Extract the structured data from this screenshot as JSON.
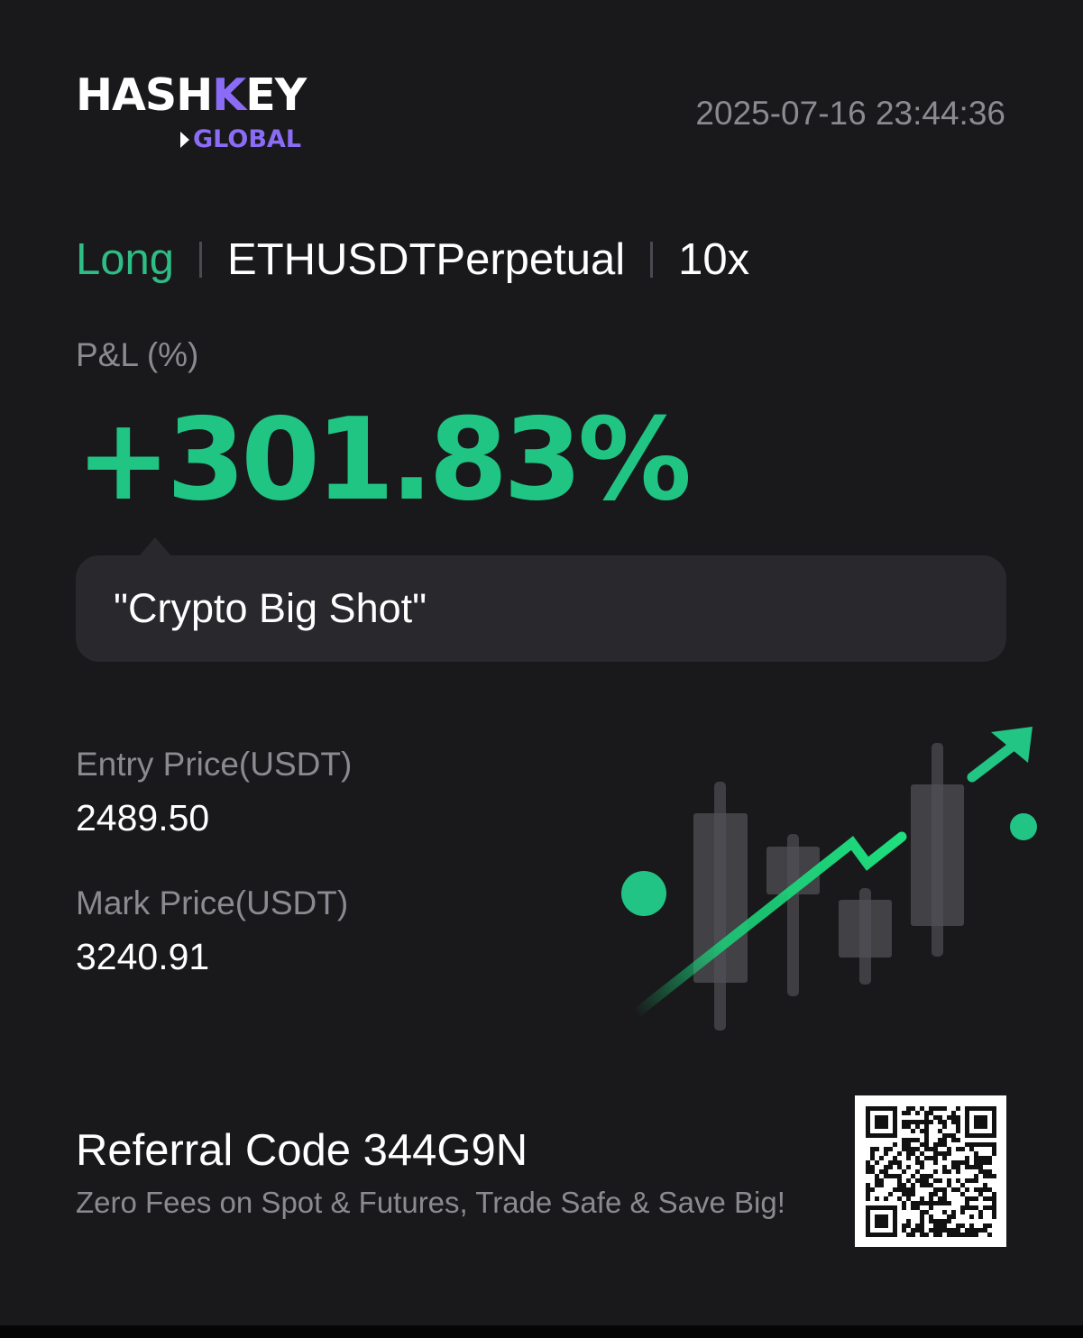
{
  "brand": {
    "logo_main": "HASHKEY",
    "logo_sub": "GLOBAL"
  },
  "timestamp": "2025-07-16 23:44:36",
  "position": {
    "side": "Long",
    "symbol": "ETHUSDTPerpetual",
    "leverage": "10x"
  },
  "pnl": {
    "label": "P&L (%)",
    "value": "+301.83%"
  },
  "quote": "\"Crypto Big Shot\"",
  "prices": {
    "entry_label": "Entry Price(USDT)",
    "entry_value": "2489.50",
    "mark_label": "Mark Price(USDT)",
    "mark_value": "3240.91"
  },
  "referral": {
    "code_text": "Referral Code 344G9N",
    "tagline": "Zero Fees on Spot & Futures, Trade Safe & Save Big!"
  },
  "colors": {
    "background": "#19191b",
    "long_green": "#2ebd85",
    "pnl_green": "#20c584",
    "brand_purple": "#8b6cf6",
    "muted_text": "#8a8a90",
    "quote_box": "#29292d"
  },
  "icons": {
    "illustration": "rising-candlestick-chart-illustration",
    "qr": "referral-qr-code"
  }
}
